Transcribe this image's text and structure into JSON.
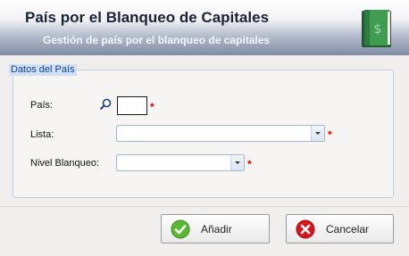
{
  "header": {
    "title": "País por el Blanqueo de Capitales",
    "subtitle": "Gestión de país por el blanqueo de capitales",
    "icon": "green-book-icon"
  },
  "group": {
    "title": "Datos del País"
  },
  "form": {
    "pais": {
      "label": "País:",
      "value": "",
      "required_mark": "*",
      "lookup_icon": "search-icon"
    },
    "lista": {
      "label": "Lista:",
      "value": "",
      "required_mark": "*"
    },
    "nivel_blanqueo": {
      "label": "Nivel Blanqueo:",
      "value": "",
      "required_mark": "*"
    }
  },
  "buttons": {
    "add": {
      "label": "Añadir",
      "icon": "check-circle-icon",
      "color": "#5bb832"
    },
    "cancel": {
      "label": "Cancelar",
      "icon": "x-circle-icon",
      "color": "#d8151d"
    }
  },
  "colors": {
    "header_gradient_end": "#7e8ba3",
    "group_title_bg": "#cfe0f7",
    "required": "#e00000"
  }
}
